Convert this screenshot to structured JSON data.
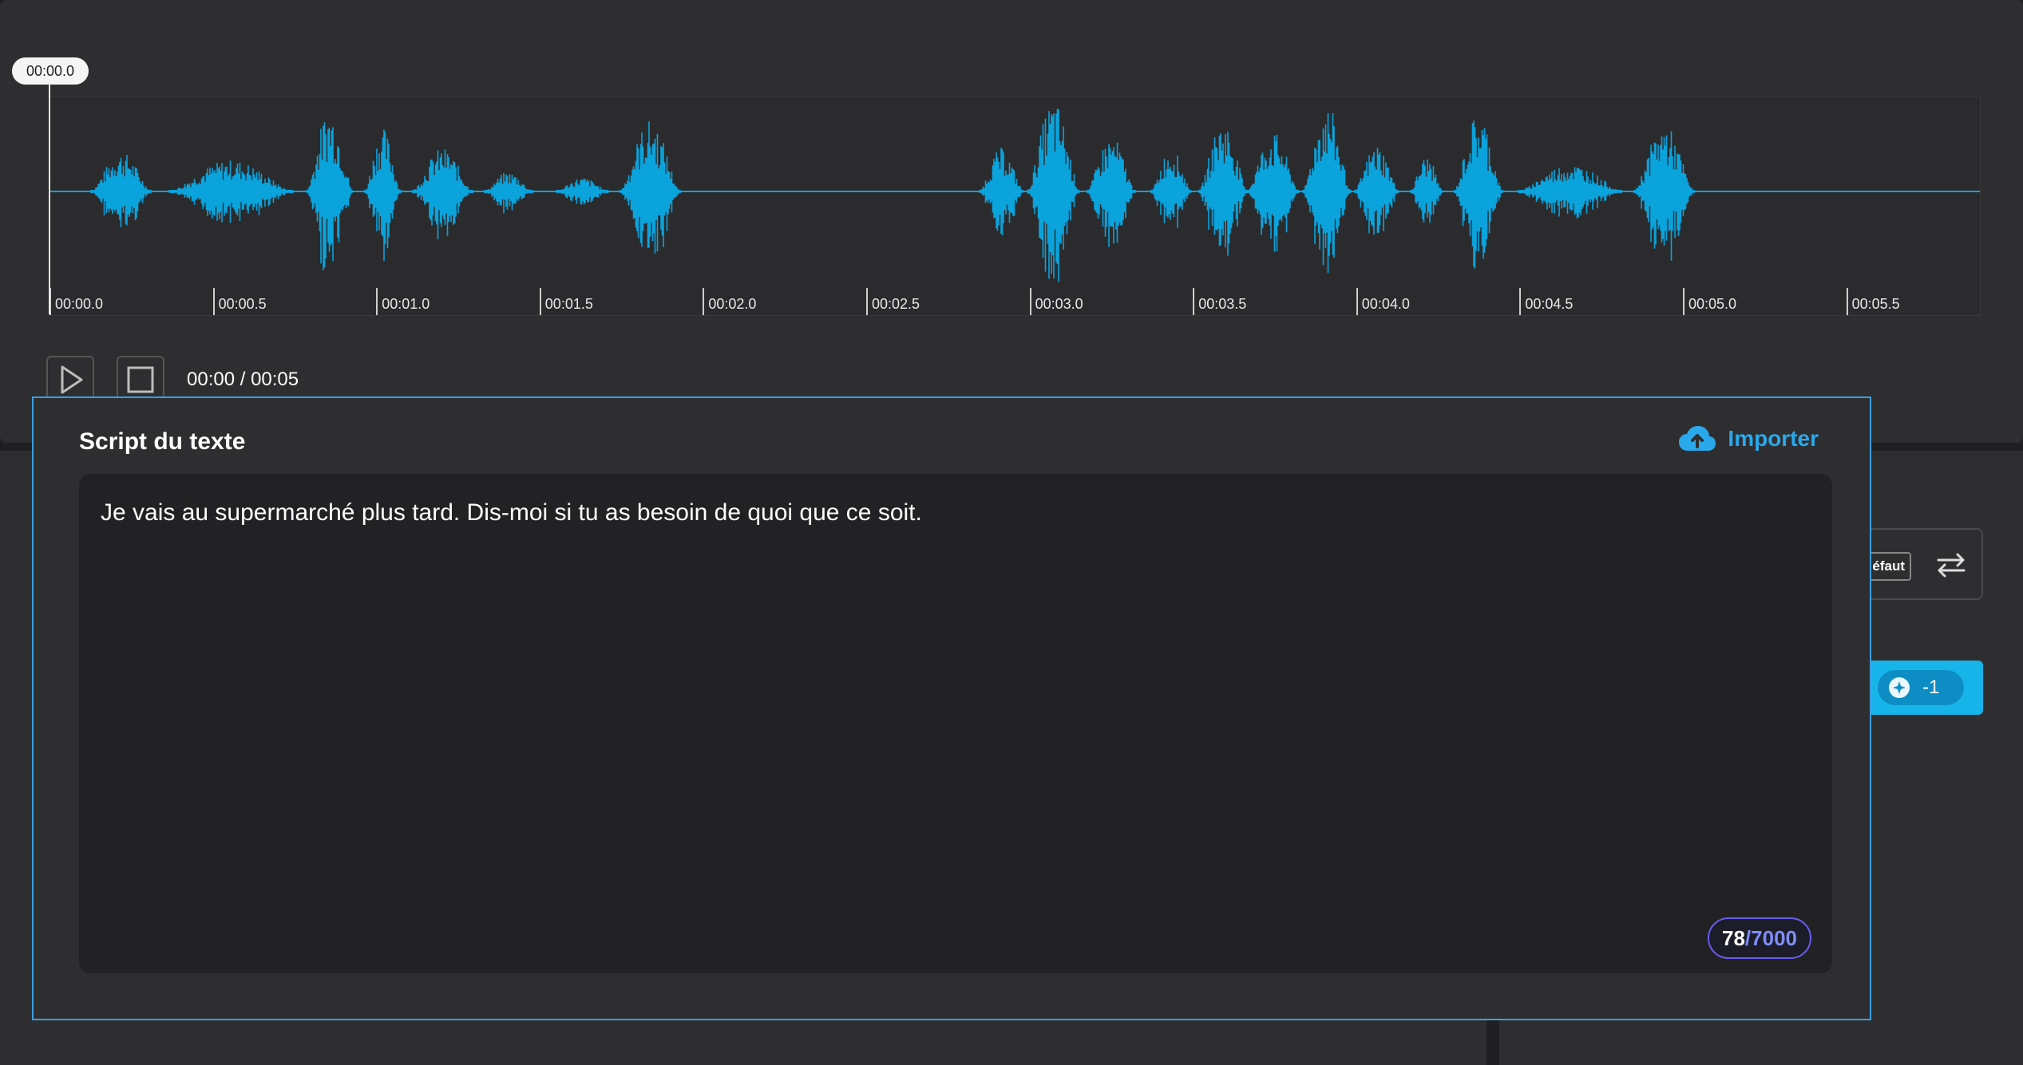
{
  "waveform": {
    "playhead_time": "00:00.0",
    "color": "#0aa3dc",
    "time_ticks": [
      "00:00.0",
      "00:00.5",
      "00:01.0",
      "00:01.5",
      "00:02.0",
      "00:02.5",
      "00:03.0",
      "00:03.5",
      "00:04.0",
      "00:04.5",
      "00:05.0",
      "00:05.5"
    ]
  },
  "player": {
    "time_display": "00:00 / 00:05",
    "play_icon": "play-icon",
    "stop_icon": "stop-icon"
  },
  "side_controls": {
    "format_chip_label": "éfaut",
    "swap_icon": "swap-arrows-icon",
    "generate_credit": "-1",
    "generate_color": "#17b4ea"
  },
  "script_dialog": {
    "title": "Script du texte",
    "import_label": "Importer",
    "import_icon": "cloud-upload-icon",
    "text": "Je vais au supermarché plus tard. Dis-moi si tu as besoin de quoi que ce soit.",
    "char_count": "78",
    "char_max": "/7000",
    "accent": "#3b9fe0"
  }
}
